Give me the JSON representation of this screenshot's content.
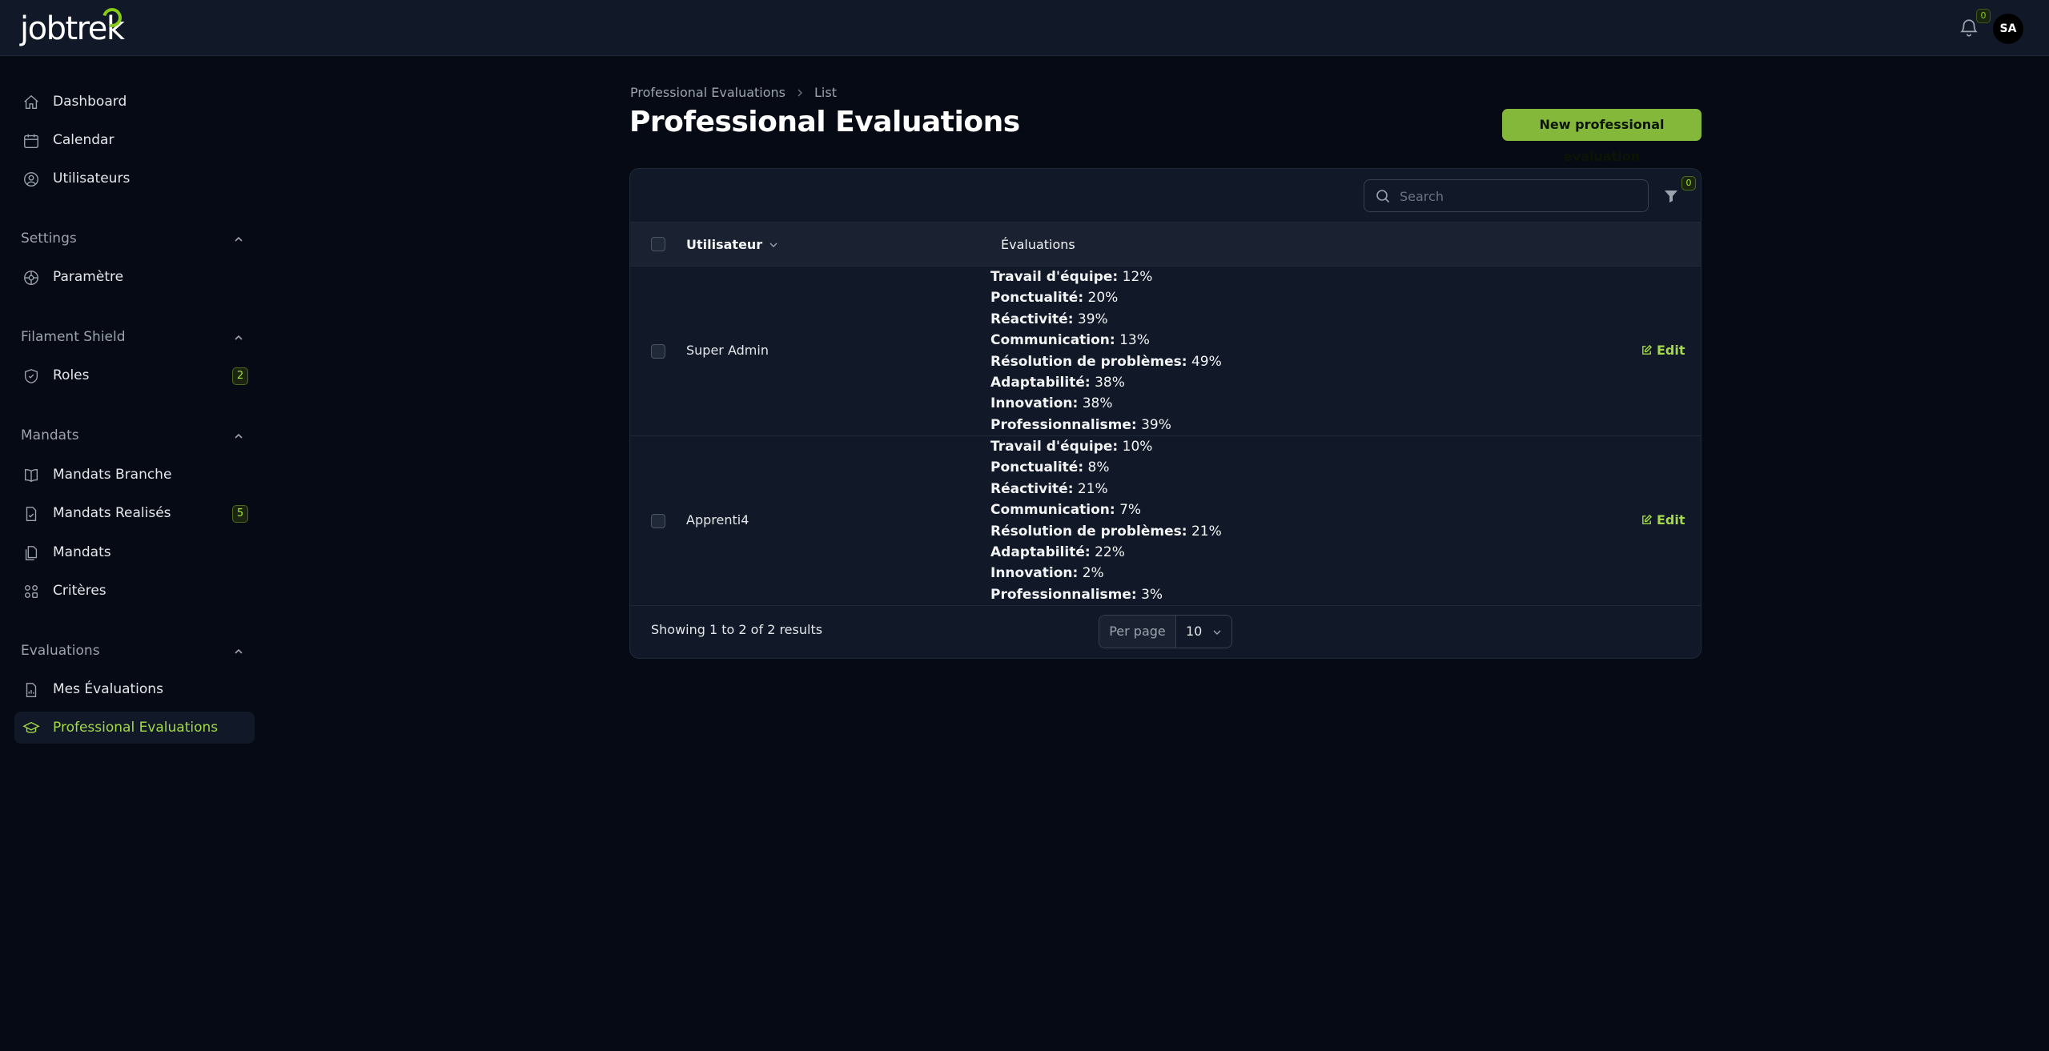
{
  "app": {
    "logo_text": "jobtrek"
  },
  "header": {
    "notifications_count": "0",
    "avatar_initials": "SA"
  },
  "sidebar": {
    "items": [
      {
        "label": "Dashboard",
        "icon": "home-icon"
      },
      {
        "label": "Calendar",
        "icon": "calendar-icon"
      },
      {
        "label": "Utilisateurs",
        "icon": "user-circle-icon"
      }
    ],
    "groups": [
      {
        "label": "Settings",
        "items": [
          {
            "label": "Paramètre",
            "icon": "gear-icon"
          }
        ]
      },
      {
        "label": "Filament Shield",
        "items": [
          {
            "label": "Roles",
            "icon": "shield-icon",
            "badge": "2"
          }
        ]
      },
      {
        "label": "Mandats",
        "items": [
          {
            "label": "Mandats Branche",
            "icon": "book-icon"
          },
          {
            "label": "Mandats Realisés",
            "icon": "document-check-icon",
            "badge": "5"
          },
          {
            "label": "Mandats",
            "icon": "documents-icon"
          },
          {
            "label": "Critères",
            "icon": "grid-icon"
          }
        ]
      },
      {
        "label": "Evaluations",
        "items": [
          {
            "label": "Mes Évaluations",
            "icon": "document-chart-icon"
          },
          {
            "label": "Professional Evaluations",
            "icon": "academic-cap-icon",
            "active": true
          }
        ]
      }
    ]
  },
  "breadcrumb": {
    "parent": "Professional Evaluations",
    "current": "List"
  },
  "page": {
    "title": "Professional Evaluations",
    "new_button_label": "New professional evaluation"
  },
  "table": {
    "search_placeholder": "Search",
    "filter_count": "0",
    "columns": {
      "user": "Utilisateur",
      "evaluations": "Évaluations"
    },
    "edit_label": "Edit",
    "rows": [
      {
        "user": "Super Admin",
        "evaluations": [
          {
            "label": "Travail d'équipe:",
            "value": "12%"
          },
          {
            "label": "Ponctualité:",
            "value": "20%"
          },
          {
            "label": "Réactivité:",
            "value": "39%"
          },
          {
            "label": "Communication:",
            "value": "13%"
          },
          {
            "label": "Résolution de problèmes:",
            "value": "49%"
          },
          {
            "label": "Adaptabilité:",
            "value": "38%"
          },
          {
            "label": "Innovation:",
            "value": "38%"
          },
          {
            "label": "Professionnalisme:",
            "value": "39%"
          }
        ]
      },
      {
        "user": "Apprenti4",
        "evaluations": [
          {
            "label": "Travail d'équipe:",
            "value": "10%"
          },
          {
            "label": "Ponctualité:",
            "value": "8%"
          },
          {
            "label": "Réactivité:",
            "value": "21%"
          },
          {
            "label": "Communication:",
            "value": "7%"
          },
          {
            "label": "Résolution de problèmes:",
            "value": "21%"
          },
          {
            "label": "Adaptabilité:",
            "value": "22%"
          },
          {
            "label": "Innovation:",
            "value": "2%"
          },
          {
            "label": "Professionnalisme:",
            "value": "3%"
          }
        ]
      }
    ],
    "footer": {
      "showing": "Showing 1 to 2 of 2 results",
      "per_page_label": "Per page",
      "per_page_value": "10"
    }
  },
  "colors": {
    "accent": "#84b83a",
    "background": "#050a14",
    "surface": "#111827"
  }
}
